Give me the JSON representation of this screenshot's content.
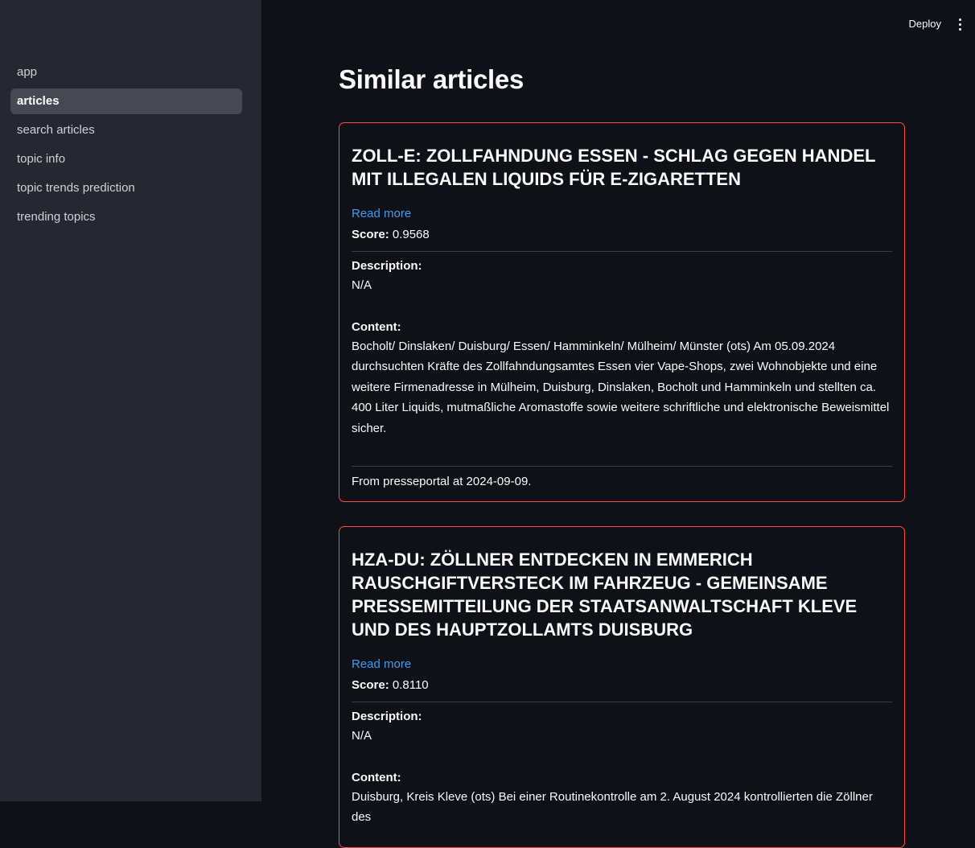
{
  "sidebar": {
    "items": [
      {
        "label": "app",
        "active": false
      },
      {
        "label": "articles",
        "active": true
      },
      {
        "label": "search articles",
        "active": false
      },
      {
        "label": "topic info",
        "active": false
      },
      {
        "label": "topic trends prediction",
        "active": false
      },
      {
        "label": "trending topics",
        "active": false
      }
    ]
  },
  "header": {
    "deploy_label": "Deploy",
    "menu_icon": "vertical-dots-icon"
  },
  "main": {
    "title": "Similar articles",
    "articles": [
      {
        "title": "ZOLL-E: ZOLLFAHNDUNG ESSEN - SCHLAG GEGEN HANDEL MIT ILLEGALEN LIQUIDS FÜR E-ZIGARETTEN",
        "read_more": "Read more",
        "score_label": "Score:",
        "score": "0.9568",
        "description_label": "Description:",
        "description": "N/A",
        "content_label": "Content:",
        "content": "Bocholt/ Dinslaken/ Duisburg/ Essen/ Hamminkeln/ Mülheim/ Münster (ots) Am 05.09.2024 durchsuchten Kräfte des Zollfahndungsamtes Essen vier Vape-Shops, zwei Wohnobjekte und eine weitere Firmenadresse in Mülheim, Duisburg, Dinslaken, Bocholt und Hamminkeln und stellten ca. 400 Liter Liquids, mutmaßliche Aromastoffe sowie weitere schriftliche und elektronische Beweismittel sicher.",
        "footer": "From presseportal at 2024-09-09."
      },
      {
        "title": "HZA-DU: ZÖLLNER ENTDECKEN IN EMMERICH RAUSCHGIFTVERSTECK IM FAHRZEUG - GEMEINSAME PRESSEMITTEILUNG DER STAATSANWALTSCHAFT KLEVE UND DES HAUPTZOLLAMTS DUISBURG",
        "read_more": "Read more",
        "score_label": "Score:",
        "score": "0.8110",
        "description_label": "Description:",
        "description": "N/A",
        "content_label": "Content:",
        "content": "Duisburg, Kreis Kleve (ots) Bei einer Routinekontrolle am 2. August 2024 kontrollierten die Zöllner des"
      }
    ]
  },
  "colors": {
    "sidebar_bg": "#262730",
    "main_bg": "#0e1117",
    "card_border": "#ff4b4b",
    "link": "#3d9df3",
    "active_nav_bg": "#464954"
  }
}
